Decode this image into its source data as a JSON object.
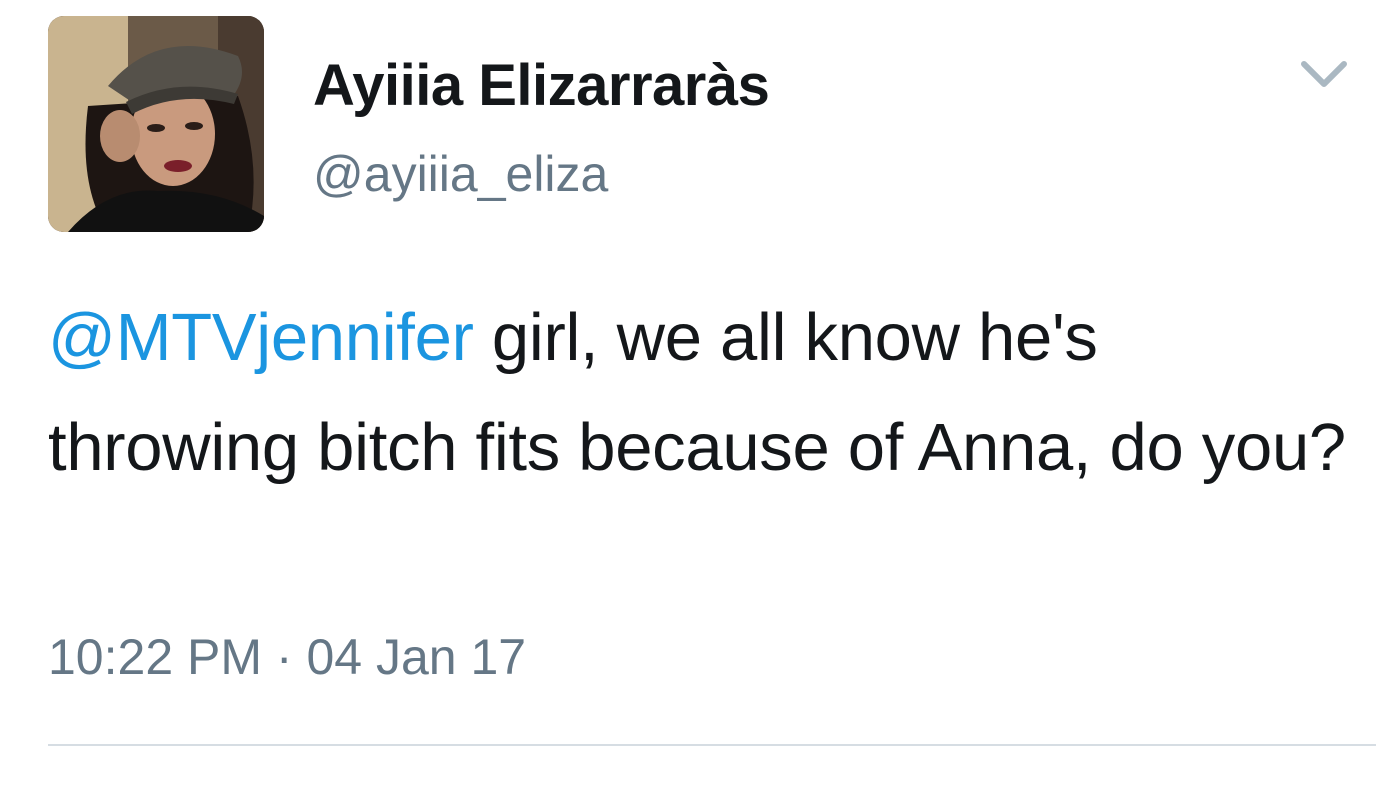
{
  "tweet": {
    "display_name": "Ayiiia Elizarraràs",
    "handle": "@ayiiia_eliza",
    "mention": "@MTVjennifer",
    "text_after_mention": " girl, we all know he's throwing bitch fits because of Anna, do you?",
    "time": "10:22 PM",
    "separator": " · ",
    "date": "04 Jan 17"
  },
  "icons": {
    "menu": "chevron-down-icon",
    "avatar": "profile-photo"
  },
  "colors": {
    "name": "#14171a",
    "secondary": "#657786",
    "link": "#1b95e0",
    "divider": "#d6dde3"
  }
}
